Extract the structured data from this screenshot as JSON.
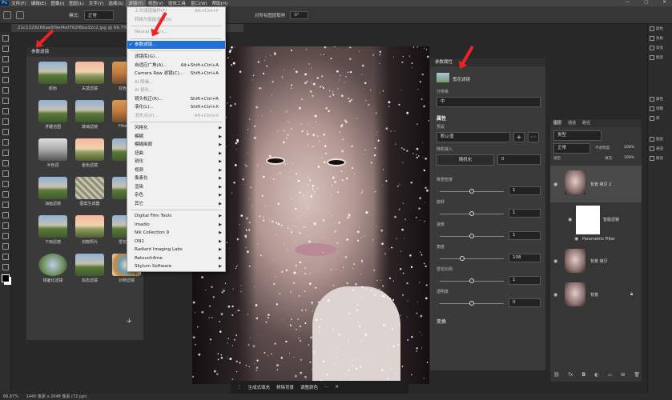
{
  "menubar": {
    "items": [
      "文件(F)",
      "编辑(E)",
      "图像(I)",
      "图层(L)",
      "文字(Y)",
      "选择(S)",
      "滤镜(T)",
      "视图(V)",
      "增效工具",
      "窗口(W)",
      "帮助(H)"
    ],
    "active_index": 6
  },
  "options": {
    "mode_label": "模式:",
    "mode_value": "正常",
    "sample_all": "对所有图层取样",
    "angle": "0°"
  },
  "document": {
    "tab_title": "21c1329266ae5f9ef4ef762f6ba32c2.jpg @ 66.7% (RG"
  },
  "filter_menu": {
    "items": [
      {
        "label": "上次滤镜操作(F)",
        "shortcut": "Alt+Ctrl+F",
        "disabled": true
      },
      {
        "label": "转换为智能滤镜(S)",
        "disabled": true,
        "sep_after": true
      },
      {
        "label": "Neural Filters...",
        "disabled": true,
        "sep_after": true
      },
      {
        "label": "参数滤镜...",
        "highlight": true,
        "sep_after": true
      },
      {
        "label": "滤镜库(G)..."
      },
      {
        "label": "自适应广角(A)...",
        "shortcut": "Alt+Shift+Ctrl+A"
      },
      {
        "label": "Camera Raw 滤镜(C)...",
        "shortcut": "Shift+Ctrl+A"
      },
      {
        "label": "AI 降噪...",
        "disabled": true
      },
      {
        "label": "AI 锐化...",
        "disabled": true
      },
      {
        "label": "镜头校正(R)...",
        "shortcut": "Shift+Ctrl+R"
      },
      {
        "label": "液化(L)...",
        "shortcut": "Shift+Ctrl+X"
      },
      {
        "label": "消失点(V)...",
        "shortcut": "Alt+Ctrl+V",
        "disabled": true,
        "sep_after": true
      },
      {
        "label": "风格化",
        "sub": true
      },
      {
        "label": "模糊",
        "sub": true
      },
      {
        "label": "模糊画廊",
        "sub": true
      },
      {
        "label": "扭曲",
        "sub": true
      },
      {
        "label": "锐化",
        "sub": true
      },
      {
        "label": "视频",
        "sub": true
      },
      {
        "label": "像素化",
        "sub": true
      },
      {
        "label": "渲染",
        "sub": true
      },
      {
        "label": "杂色",
        "sub": true
      },
      {
        "label": "其它",
        "sub": true,
        "sep_after": true
      },
      {
        "label": "Digital Film Tools",
        "sub": true
      },
      {
        "label": "Imadio",
        "sub": true
      },
      {
        "label": "Nik Collection 9",
        "sub": true
      },
      {
        "label": "ON1",
        "sub": true
      },
      {
        "label": "Radiant Imaging Labs",
        "sub": true
      },
      {
        "label": "Retouch4me",
        "sub": true
      },
      {
        "label": "Skylum Software",
        "sub": true
      },
      {
        "label": "Topaz Labs Studio",
        "sub": true
      }
    ]
  },
  "filter_panel": {
    "title": "参数滤镜",
    "items": [
      {
        "label": "颜色",
        "style": ""
      },
      {
        "label": "夫莫滤镜",
        "style": "t2"
      },
      {
        "label": "双色滤镜",
        "style": "t3"
      },
      {
        "label": "浮雕范围",
        "style": ""
      },
      {
        "label": "玻璃滤镜",
        "style": ""
      },
      {
        "label": "Filter Gr",
        "style": "t3"
      },
      {
        "label": "半色调",
        "style": "gray"
      },
      {
        "label": "金色滤镜",
        "style": "t2"
      },
      {
        "label": "",
        "style": ""
      },
      {
        "label": "油画滤镜",
        "style": ""
      },
      {
        "label": "图案生成器",
        "style": "pat"
      },
      {
        "label": "",
        "style": ""
      },
      {
        "label": "下雨滤镜",
        "style": ""
      },
      {
        "label": "划痕照片",
        "style": "t2"
      },
      {
        "label": "雪花滤镜",
        "style": ""
      },
      {
        "label": "镜面化滤镜",
        "style": "circ"
      },
      {
        "label": "拟态滤镜",
        "style": ""
      },
      {
        "label": "对称滤镜",
        "style": "mand"
      }
    ],
    "add_label": "+"
  },
  "properties": {
    "header": "参数属性",
    "filter_name": "雪花滤镜",
    "category_label": "分辨率",
    "category_value": "中",
    "section_title": "属性",
    "preset_label": "预设",
    "preset_value": "默认值",
    "random_label": "随机输入",
    "random_button": "随机化",
    "random_value": "0",
    "sliders": [
      {
        "label": "降雪密度",
        "value": "1",
        "level": 0.5
      },
      {
        "label": "旋转",
        "value": "1",
        "level": 0.5
      },
      {
        "label": "速度",
        "value": "1",
        "level": 0.5
      },
      {
        "label": "角度",
        "value": "108",
        "level": 0.35
      },
      {
        "label": "雪花比例",
        "value": "1",
        "level": 0.5
      },
      {
        "label": "透明度",
        "value": "0",
        "level": 0.5
      }
    ],
    "transform_label": "变换"
  },
  "layers": {
    "tabs": [
      "图层",
      "通道",
      "路径"
    ],
    "kind_value": "类型",
    "blend_value": "正常",
    "opacity_label": "不透明度:",
    "opacity_value": "100%",
    "lock_label": "锁定:",
    "fill_label": "填充:",
    "fill_value": "100%",
    "rows": [
      {
        "name": "背景 拷贝 2"
      },
      {
        "name": "智能滤镜"
      },
      {
        "name": "Parametric Filter"
      },
      {
        "name": "背景 拷贝"
      },
      {
        "name": "背景"
      }
    ]
  },
  "right_panels": [
    "颜色",
    "色板",
    "渐变",
    "图案",
    "属性",
    "调整",
    "库",
    "图层",
    "通道",
    "路径"
  ],
  "context_bar": {
    "items": [
      "生成式填充",
      "移除背景",
      "调整颜色"
    ]
  },
  "status": {
    "zoom": "66.67%",
    "info": "1440 像素 x 2048 像素 (72 ppi)"
  }
}
